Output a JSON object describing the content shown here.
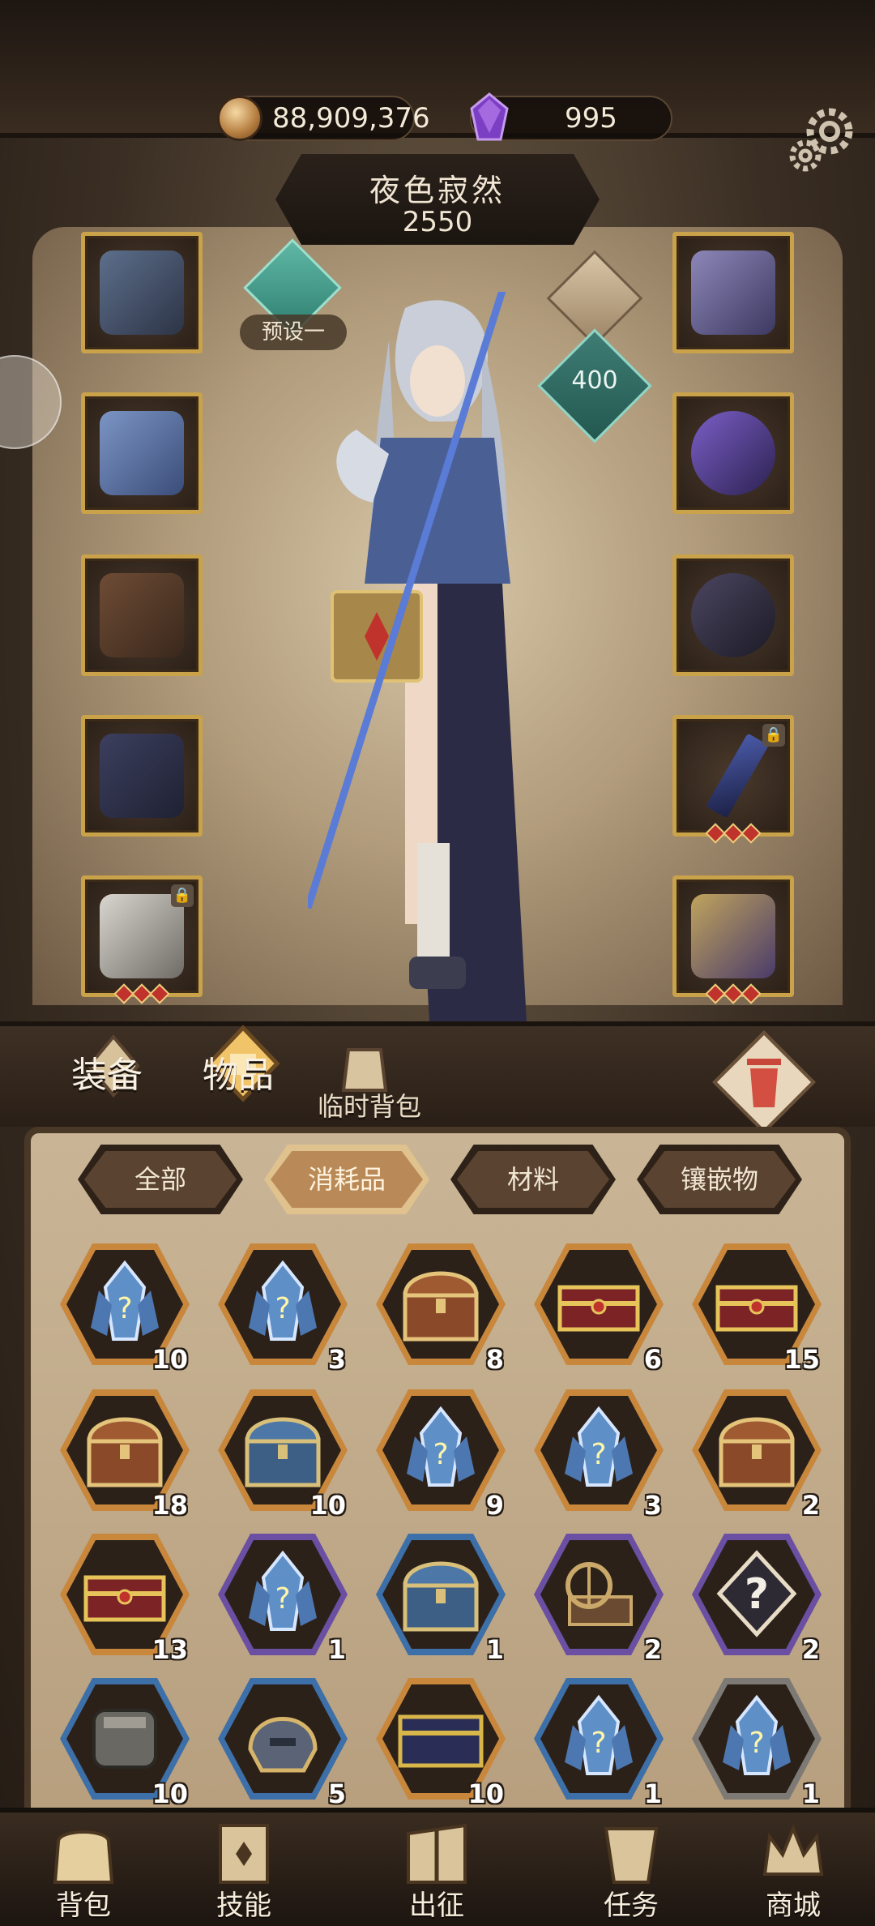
{
  "currency": {
    "gold": "88,909,376",
    "gems": "995"
  },
  "hero": {
    "name": "夜色寂然",
    "power": "2550",
    "preset_label": "预设一",
    "badge_value": "400"
  },
  "main_tabs": {
    "equipment": "装备",
    "items": "物品",
    "temp_bag": "临时背包"
  },
  "filters": [
    "全部",
    "消耗品",
    "材料",
    "镶嵌物"
  ],
  "active_filter": "消耗品",
  "items": [
    {
      "kind": "crystal",
      "frame": "orange",
      "count": "10"
    },
    {
      "kind": "crystal",
      "frame": "orange",
      "count": "3"
    },
    {
      "kind": "chest-gold",
      "frame": "orange",
      "count": "8"
    },
    {
      "kind": "chest-red",
      "frame": "orange",
      "count": "6"
    },
    {
      "kind": "chest-red",
      "frame": "orange",
      "count": "15"
    },
    {
      "kind": "chest-gold",
      "frame": "orange",
      "count": "18"
    },
    {
      "kind": "chest-blue",
      "frame": "orange",
      "count": "10"
    },
    {
      "kind": "crystal",
      "frame": "orange",
      "count": "9"
    },
    {
      "kind": "crystal",
      "frame": "orange",
      "count": "3"
    },
    {
      "kind": "chest-gold",
      "frame": "orange",
      "count": "2"
    },
    {
      "kind": "chest-red",
      "frame": "orange",
      "count": "13"
    },
    {
      "kind": "crystal",
      "frame": "purple",
      "count": "1"
    },
    {
      "kind": "chest-blue",
      "frame": "blue",
      "count": "1"
    },
    {
      "kind": "device",
      "frame": "purple",
      "count": "2"
    },
    {
      "kind": "mystery",
      "frame": "purple",
      "count": "2"
    },
    {
      "kind": "scroll",
      "frame": "blue",
      "count": "10"
    },
    {
      "kind": "helm",
      "frame": "blue",
      "count": "5"
    },
    {
      "kind": "chest-dark",
      "frame": "orange",
      "count": "10"
    },
    {
      "kind": "crystal",
      "frame": "blue",
      "count": "1"
    },
    {
      "kind": "crystal",
      "frame": "grey",
      "count": "1"
    }
  ],
  "bottom_nav": [
    "背包",
    "技能",
    "出征",
    "任务",
    "商城"
  ],
  "colors": {
    "gold_frame": "#c9a24a",
    "orange_frame": "#c9873c",
    "purple_frame": "#6a4fa3",
    "blue_frame": "#3d6fa8",
    "grey_frame": "#7d7a76",
    "active_tab": "#b98a57"
  }
}
